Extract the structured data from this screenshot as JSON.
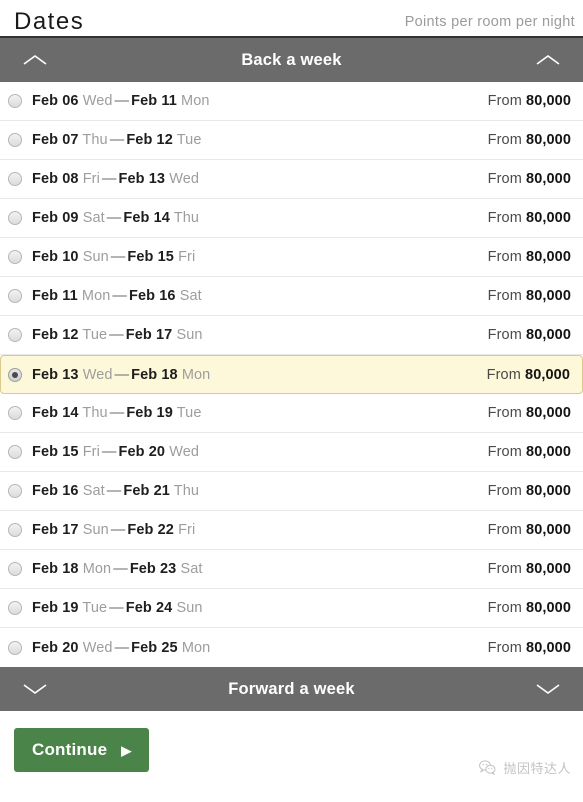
{
  "header": {
    "title": "Dates",
    "note": "Points per room per night"
  },
  "nav": {
    "back": {
      "label": "Back a week",
      "icon_left": "chevron-up-icon",
      "icon_right": "chevron-up-icon"
    },
    "forward": {
      "label": "Forward a week",
      "icon_left": "chevron-down-icon",
      "icon_right": "chevron-down-icon"
    }
  },
  "price_prefix": "From",
  "rows": [
    {
      "start_date": "Feb 06",
      "start_day": "Wed",
      "dash": "—",
      "end_date": "Feb 11",
      "end_day": "Mon",
      "prefix": "From",
      "amount": "80,000",
      "selected": false
    },
    {
      "start_date": "Feb 07",
      "start_day": "Thu",
      "dash": "—",
      "end_date": "Feb 12",
      "end_day": "Tue",
      "prefix": "From",
      "amount": "80,000",
      "selected": false
    },
    {
      "start_date": "Feb 08",
      "start_day": "Fri",
      "dash": "—",
      "end_date": "Feb 13",
      "end_day": "Wed",
      "prefix": "From",
      "amount": "80,000",
      "selected": false
    },
    {
      "start_date": "Feb 09",
      "start_day": "Sat",
      "dash": "—",
      "end_date": "Feb 14",
      "end_day": "Thu",
      "prefix": "From",
      "amount": "80,000",
      "selected": false
    },
    {
      "start_date": "Feb 10",
      "start_day": "Sun",
      "dash": "—",
      "end_date": "Feb 15",
      "end_day": "Fri",
      "prefix": "From",
      "amount": "80,000",
      "selected": false
    },
    {
      "start_date": "Feb 11",
      "start_day": "Mon",
      "dash": "—",
      "end_date": "Feb 16",
      "end_day": "Sat",
      "prefix": "From",
      "amount": "80,000",
      "selected": false
    },
    {
      "start_date": "Feb 12",
      "start_day": "Tue",
      "dash": "—",
      "end_date": "Feb 17",
      "end_day": "Sun",
      "prefix": "From",
      "amount": "80,000",
      "selected": false
    },
    {
      "start_date": "Feb 13",
      "start_day": "Wed",
      "dash": "—",
      "end_date": "Feb 18",
      "end_day": "Mon",
      "prefix": "From",
      "amount": "80,000",
      "selected": true
    },
    {
      "start_date": "Feb 14",
      "start_day": "Thu",
      "dash": "—",
      "end_date": "Feb 19",
      "end_day": "Tue",
      "prefix": "From",
      "amount": "80,000",
      "selected": false
    },
    {
      "start_date": "Feb 15",
      "start_day": "Fri",
      "dash": "—",
      "end_date": "Feb 20",
      "end_day": "Wed",
      "prefix": "From",
      "amount": "80,000",
      "selected": false
    },
    {
      "start_date": "Feb 16",
      "start_day": "Sat",
      "dash": "—",
      "end_date": "Feb 21",
      "end_day": "Thu",
      "prefix": "From",
      "amount": "80,000",
      "selected": false
    },
    {
      "start_date": "Feb 17",
      "start_day": "Sun",
      "dash": "—",
      "end_date": "Feb 22",
      "end_day": "Fri",
      "prefix": "From",
      "amount": "80,000",
      "selected": false
    },
    {
      "start_date": "Feb 18",
      "start_day": "Mon",
      "dash": "—",
      "end_date": "Feb 23",
      "end_day": "Sat",
      "prefix": "From",
      "amount": "80,000",
      "selected": false
    },
    {
      "start_date": "Feb 19",
      "start_day": "Tue",
      "dash": "—",
      "end_date": "Feb 24",
      "end_day": "Sun",
      "prefix": "From",
      "amount": "80,000",
      "selected": false
    },
    {
      "start_date": "Feb 20",
      "start_day": "Wed",
      "dash": "—",
      "end_date": "Feb 25",
      "end_day": "Mon",
      "prefix": "From",
      "amount": "80,000",
      "selected": false
    }
  ],
  "footer": {
    "continue_label": "Continue",
    "continue_caret": "▶",
    "watermark_text": "抛因特达人",
    "watermark_icon": "wechat-logo-icon"
  },
  "colors": {
    "navbar_gray": "#6b6b6b",
    "selected_row_bg": "#fdf8d9",
    "selected_row_border": "#d9c98a",
    "continue_green": "#4a8448",
    "muted_text": "#9d9d9d"
  }
}
